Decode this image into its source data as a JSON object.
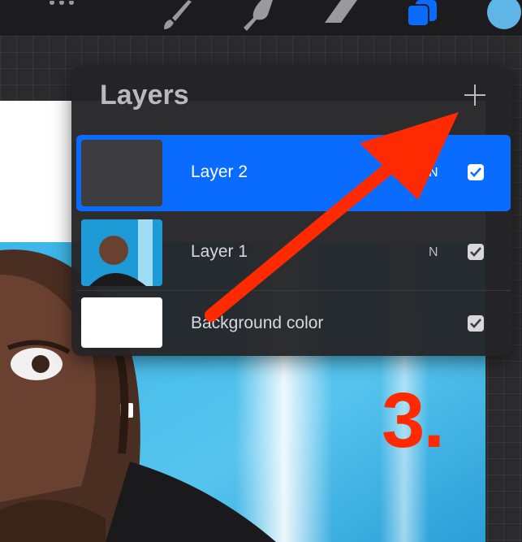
{
  "panel": {
    "title": "Layers",
    "layers": [
      {
        "name": "Layer 2",
        "blend": "N",
        "visible": true,
        "selected": true
      },
      {
        "name": "Layer 1",
        "blend": "N",
        "visible": true,
        "selected": false
      },
      {
        "name": "Background color",
        "blend": "",
        "visible": true,
        "selected": false
      }
    ]
  },
  "annotation": {
    "step": "3."
  },
  "colors": {
    "selection": "#0a6cff",
    "arrow": "#ff2a00",
    "avatar": "#5fb6e6"
  },
  "icons": [
    "actions-icon",
    "brush-icon",
    "smudge-icon",
    "eraser-icon",
    "layers-icon",
    "color-swatch",
    "add-layer-icon",
    "checkbox-icon"
  ]
}
